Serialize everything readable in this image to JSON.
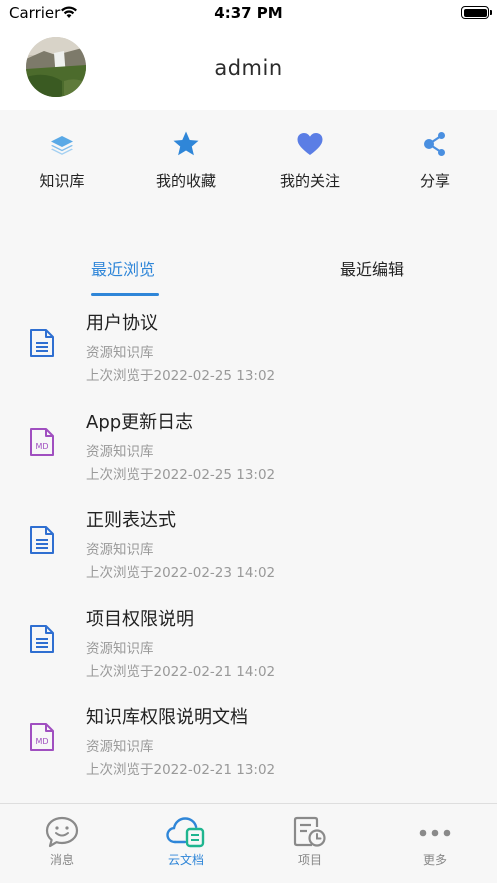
{
  "status_bar": {
    "carrier": "Carrier",
    "time": "4:37 PM"
  },
  "profile": {
    "username": "admin"
  },
  "quick_links": [
    {
      "label": "知识库",
      "icon": "layers-icon",
      "color": "#5aa9e6"
    },
    {
      "label": "我的收藏",
      "icon": "star-icon",
      "color": "#2f86d8"
    },
    {
      "label": "我的关注",
      "icon": "heart-icon",
      "color": "#5b7ee5"
    },
    {
      "label": "分享",
      "icon": "share-icon",
      "color": "#4a8fe0"
    }
  ],
  "tabs": [
    {
      "label": "最近浏览",
      "active": true
    },
    {
      "label": "最近编辑",
      "active": false
    }
  ],
  "documents": [
    {
      "title": "用户协议",
      "repo": "资源知识库",
      "time": "上次浏览于2022-02-25 13:02",
      "icon": "document-icon"
    },
    {
      "title": "App更新日志",
      "repo": "资源知识库",
      "time": "上次浏览于2022-02-25 13:02",
      "icon": "markdown-file-icon"
    },
    {
      "title": "正则表达式",
      "repo": "资源知识库",
      "time": "上次浏览于2022-02-23 14:02",
      "icon": "document-icon"
    },
    {
      "title": "项目权限说明",
      "repo": "资源知识库",
      "time": "上次浏览于2022-02-21 14:02",
      "icon": "document-icon"
    },
    {
      "title": "知识库权限说明文档",
      "repo": "资源知识库",
      "time": "上次浏览于2022-02-21 13:02",
      "icon": "markdown-file-icon"
    }
  ],
  "tab_bar": [
    {
      "label": "消息",
      "icon": "chat-bubble-icon",
      "active": false
    },
    {
      "label": "云文档",
      "icon": "cloud-document-icon",
      "active": true
    },
    {
      "label": "项目",
      "icon": "project-clock-icon",
      "active": false
    },
    {
      "label": "更多",
      "icon": "more-dots-icon",
      "active": false
    }
  ],
  "colors": {
    "accent": "#2f86d8",
    "doc_icon": "#2f6fd1",
    "md_icon": "#a04fc0",
    "muted": "#999999"
  }
}
